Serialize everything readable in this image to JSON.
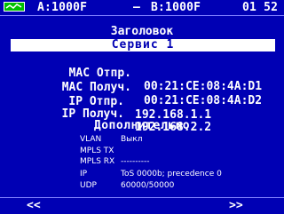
{
  "status": {
    "port_a": "A:1000F",
    "separator": "–",
    "port_b": "B:1000F",
    "time": "01 52",
    "logo_icon": "signal-wave-icon",
    "logo_color": "#00c000"
  },
  "main": {
    "heading": "Заголовок",
    "selected_item": "Сервис 1",
    "fields": [
      {
        "label": "MAC Отпр.",
        "value": "00:21:CE:08:4A:D1"
      },
      {
        "label": "MAC Получ.",
        "value": "00:21:CE:08:4A:D2"
      },
      {
        "label": "IP Отпр.",
        "value": "192.168.1.1"
      },
      {
        "label": "IP Получ.",
        "value": "192.168.2.2"
      }
    ]
  },
  "extra": {
    "heading": "Дополнительно",
    "rows": [
      {
        "label": "VLAN",
        "value": "Выкл"
      },
      {
        "label": "MPLS TX",
        "value": ""
      },
      {
        "label": "MPLS RX",
        "value": "----------"
      },
      {
        "label": "IP",
        "value": "ToS 0000b; precedence 0"
      },
      {
        "label": "UDP",
        "value": "60000/50000"
      }
    ]
  },
  "nav": {
    "prev": "<<",
    "next": ">>"
  },
  "colors": {
    "background": "#0000b4",
    "text": "#ffffff",
    "highlight": "#ffffff"
  }
}
